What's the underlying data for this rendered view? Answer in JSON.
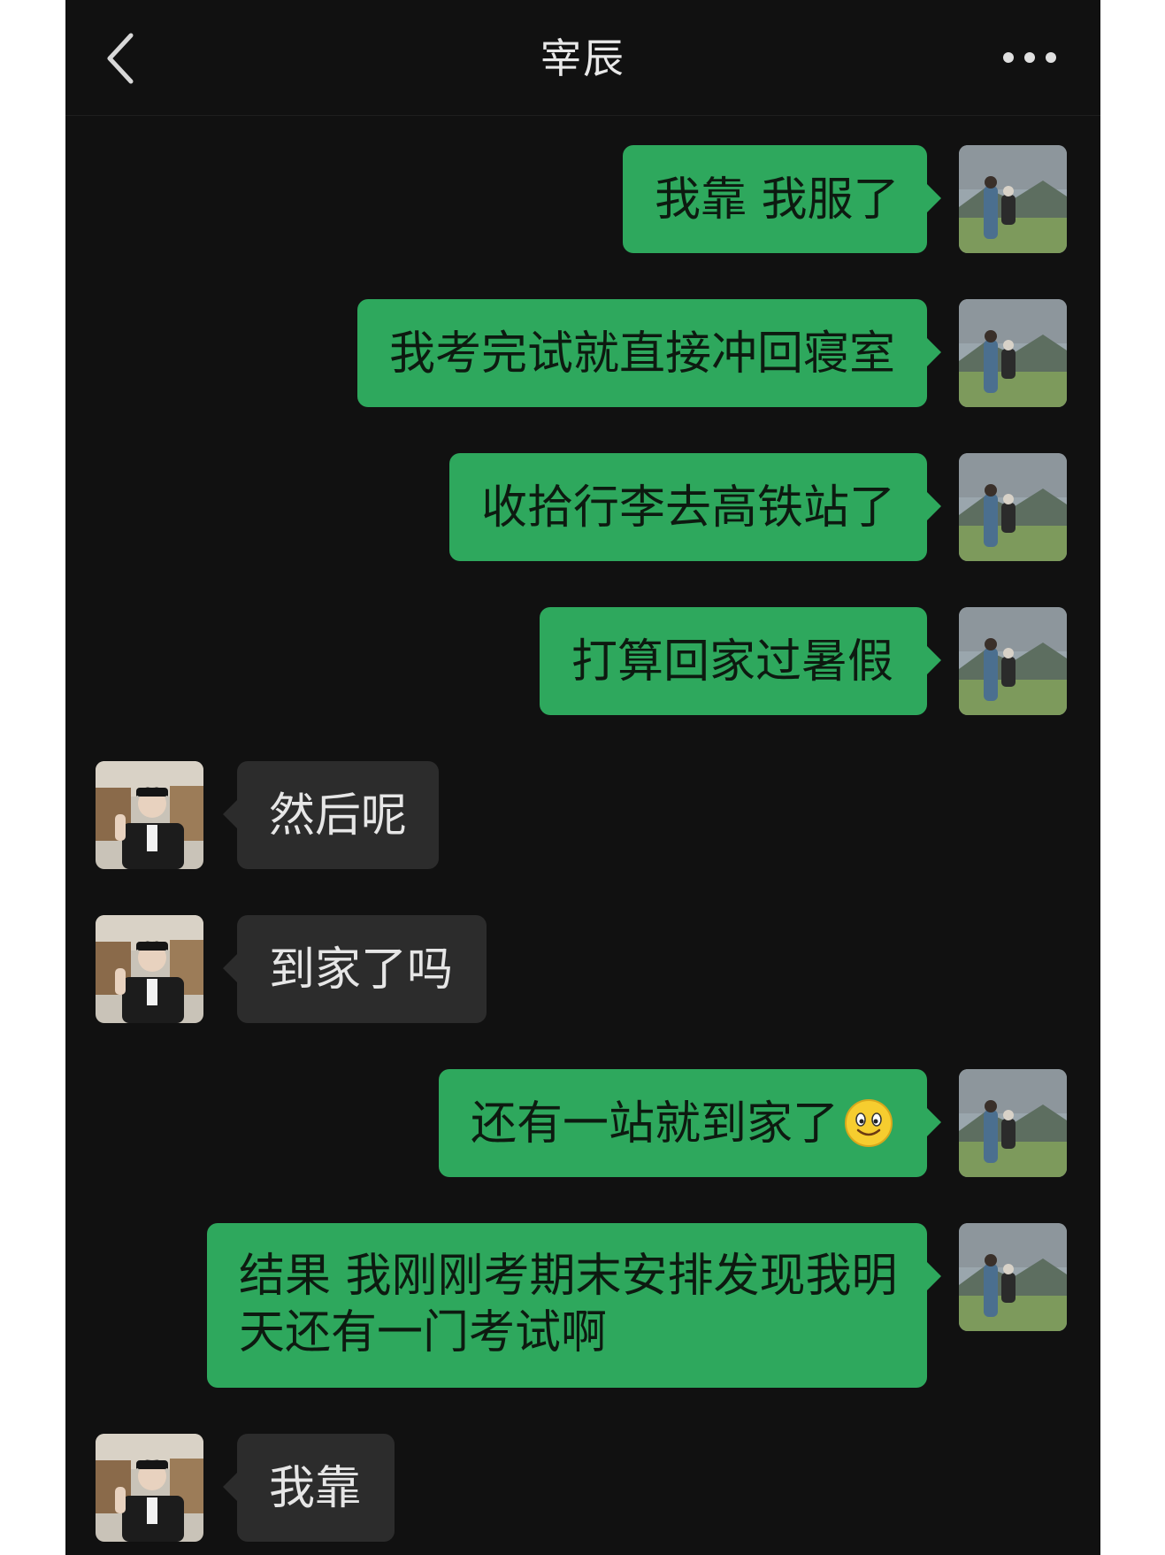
{
  "header": {
    "title": "宰辰"
  },
  "messages": [
    {
      "dir": "out",
      "text": "我靠 我服了"
    },
    {
      "dir": "out",
      "text": "我考完试就直接冲回寝室"
    },
    {
      "dir": "out",
      "text": "收拾行李去高铁站了"
    },
    {
      "dir": "out",
      "text": "打算回家过暑假"
    },
    {
      "dir": "in",
      "text": "然后呢"
    },
    {
      "dir": "in",
      "text": "到家了吗"
    },
    {
      "dir": "out",
      "text": "还有一站就到家了",
      "emoji": "smile-emoji-icon"
    },
    {
      "dir": "out",
      "text_line1": "结果 我刚刚考期末安排发现我明",
      "text_line2": "天还有一门考试啊"
    },
    {
      "dir": "in",
      "text": "我靠"
    }
  ],
  "colors": {
    "background": "#111111",
    "out_bubble": "#2ea85d",
    "in_bubble": "#2c2c2c"
  }
}
